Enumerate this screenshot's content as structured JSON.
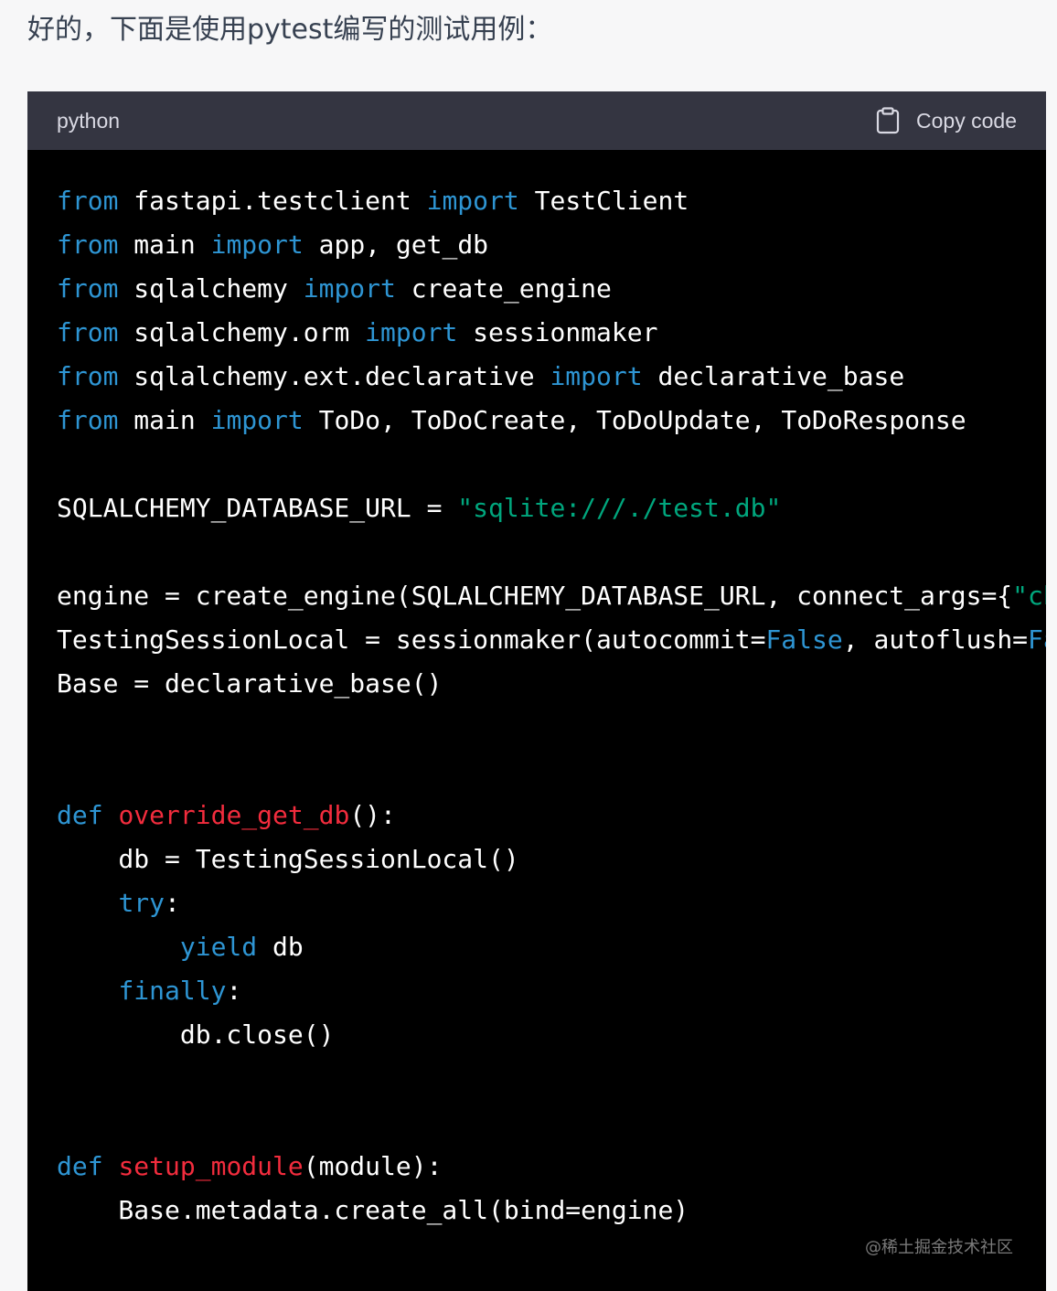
{
  "intro_text": "好的，下面是使用pytest编写的测试用例：",
  "code_block": {
    "language": "python",
    "copy_label": "Copy code",
    "copy_icon": "clipboard-icon",
    "colors": {
      "header_bg": "#343541",
      "body_bg": "#000000",
      "keyword": "#2e95d3",
      "string": "#00a67d",
      "function_name": "#f22c3d",
      "text": "#ffffff"
    },
    "lines": [
      [
        {
          "t": "kw",
          "v": "from"
        },
        {
          "t": "plain",
          "v": " fastapi.testclient "
        },
        {
          "t": "kw",
          "v": "import"
        },
        {
          "t": "plain",
          "v": " TestClient"
        }
      ],
      [
        {
          "t": "kw",
          "v": "from"
        },
        {
          "t": "plain",
          "v": " main "
        },
        {
          "t": "kw",
          "v": "import"
        },
        {
          "t": "plain",
          "v": " app, get_db"
        }
      ],
      [
        {
          "t": "kw",
          "v": "from"
        },
        {
          "t": "plain",
          "v": " sqlalchemy "
        },
        {
          "t": "kw",
          "v": "import"
        },
        {
          "t": "plain",
          "v": " create_engine"
        }
      ],
      [
        {
          "t": "kw",
          "v": "from"
        },
        {
          "t": "plain",
          "v": " sqlalchemy.orm "
        },
        {
          "t": "kw",
          "v": "import"
        },
        {
          "t": "plain",
          "v": " sessionmaker"
        }
      ],
      [
        {
          "t": "kw",
          "v": "from"
        },
        {
          "t": "plain",
          "v": " sqlalchemy.ext.declarative "
        },
        {
          "t": "kw",
          "v": "import"
        },
        {
          "t": "plain",
          "v": " declarative_base"
        }
      ],
      [
        {
          "t": "kw",
          "v": "from"
        },
        {
          "t": "plain",
          "v": " main "
        },
        {
          "t": "kw",
          "v": "import"
        },
        {
          "t": "plain",
          "v": " ToDo, ToDoCreate, ToDoUpdate, ToDoResponse"
        }
      ],
      [],
      [
        {
          "t": "plain",
          "v": "SQLALCHEMY_DATABASE_URL = "
        },
        {
          "t": "str",
          "v": "\"sqlite:///./test.db\""
        }
      ],
      [],
      [
        {
          "t": "plain",
          "v": "engine = create_engine(SQLALCHEMY_DATABASE_URL, connect_args={"
        },
        {
          "t": "str",
          "v": "\"ch"
        }
      ],
      [
        {
          "t": "plain",
          "v": "TestingSessionLocal = sessionmaker(autocommit="
        },
        {
          "t": "kw",
          "v": "False"
        },
        {
          "t": "plain",
          "v": ", autoflush="
        },
        {
          "t": "kw",
          "v": "Fa"
        }
      ],
      [
        {
          "t": "plain",
          "v": "Base = declarative_base()"
        }
      ],
      [],
      [],
      [
        {
          "t": "kw",
          "v": "def"
        },
        {
          "t": "plain",
          "v": " "
        },
        {
          "t": "fn",
          "v": "override_get_db"
        },
        {
          "t": "plain",
          "v": "():"
        }
      ],
      [
        {
          "t": "plain",
          "v": "    db = TestingSessionLocal()"
        }
      ],
      [
        {
          "t": "plain",
          "v": "    "
        },
        {
          "t": "kw",
          "v": "try"
        },
        {
          "t": "plain",
          "v": ":"
        }
      ],
      [
        {
          "t": "plain",
          "v": "        "
        },
        {
          "t": "kw",
          "v": "yield"
        },
        {
          "t": "plain",
          "v": " db"
        }
      ],
      [
        {
          "t": "plain",
          "v": "    "
        },
        {
          "t": "kw",
          "v": "finally"
        },
        {
          "t": "plain",
          "v": ":"
        }
      ],
      [
        {
          "t": "plain",
          "v": "        db.close()"
        }
      ],
      [],
      [],
      [
        {
          "t": "kw",
          "v": "def"
        },
        {
          "t": "plain",
          "v": " "
        },
        {
          "t": "fn",
          "v": "setup_module"
        },
        {
          "t": "plain",
          "v": "(module):"
        }
      ],
      [
        {
          "t": "plain",
          "v": "    Base.metadata.create_all(bind=engine)"
        }
      ]
    ]
  },
  "watermark": "@稀土掘金技术社区"
}
